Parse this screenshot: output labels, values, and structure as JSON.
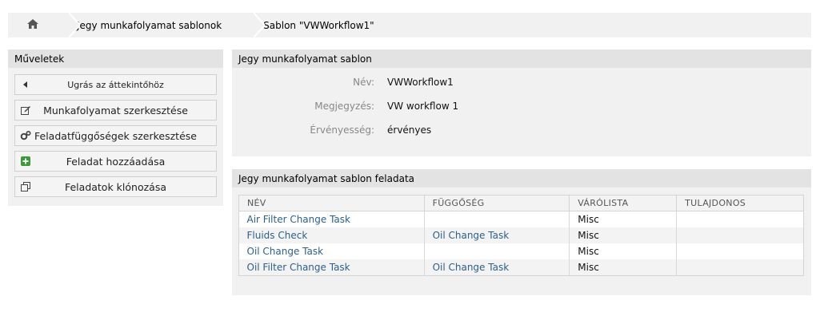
{
  "breadcrumb": {
    "home_icon": "home-icon",
    "items": [
      "Jegy munkafolyamat sablonok",
      "Sablon \"VWWorkflow1\""
    ]
  },
  "sidebar": {
    "title": "Műveletek",
    "actions": [
      {
        "label": "Ugrás az áttekintőhöz",
        "icon": "caret-left-icon"
      },
      {
        "label": "Munkafolyamat szerkesztése",
        "icon": "edit-icon"
      },
      {
        "label": "Feladatfüggőségek szerkesztése",
        "icon": "gears-icon"
      },
      {
        "label": "Feladat hozzáadása",
        "icon": "plus-square-icon"
      },
      {
        "label": "Feladatok klónozása",
        "icon": "clone-icon"
      }
    ]
  },
  "template": {
    "title": "Jegy munkafolyamat sablon",
    "fields": [
      {
        "label": "Név:",
        "value": "VWWorkflow1"
      },
      {
        "label": "Megjegyzés:",
        "value": "VW workflow 1"
      },
      {
        "label": "Érvényesség:",
        "value": "érvényes"
      }
    ]
  },
  "tasks": {
    "title": "Jegy munkafolyamat sablon feladata",
    "columns": [
      "NÉV",
      "FÜGGŐSÉG",
      "VÁRÓLISTA",
      "TULAJDONOS"
    ],
    "rows": [
      [
        "Air Filter Change Task",
        "",
        "Misc",
        ""
      ],
      [
        "Fluids Check",
        "Oil Change Task",
        "Misc",
        ""
      ],
      [
        "Oil Change Task",
        "",
        "Misc",
        ""
      ],
      [
        "Oil Filter Change Task",
        "Oil Change Task",
        "Misc",
        ""
      ]
    ]
  },
  "colors": {
    "link": "#2d5f8a",
    "panel": "#f1f1f1",
    "header": "#e3e3e3"
  }
}
